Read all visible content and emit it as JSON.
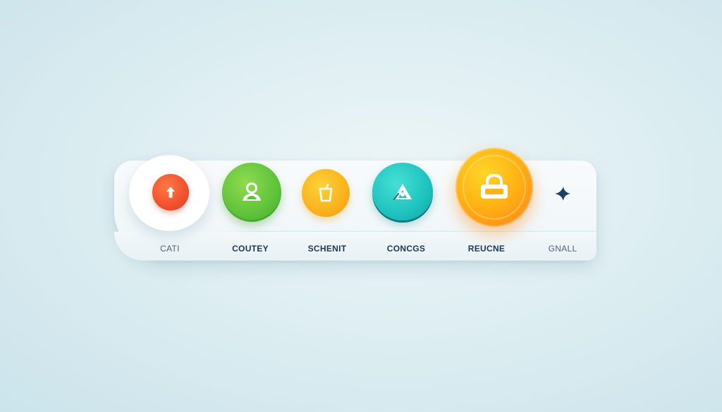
{
  "dock": {
    "items": [
      {
        "id": "cati",
        "label": "CATI",
        "color": "#f0502f",
        "icon": "arrow-up-icon"
      },
      {
        "id": "coutey",
        "label": "COUTEY",
        "color": "#5fc23a",
        "icon": "user-icon"
      },
      {
        "id": "schenit",
        "label": "SCHENIT",
        "color": "#f9b21c",
        "icon": "cup-icon"
      },
      {
        "id": "concgs",
        "label": "CONCGS",
        "color": "#1ec2be",
        "icon": "triangle-icon"
      },
      {
        "id": "reucne",
        "label": "REUCNE",
        "color": "#ff9f18",
        "icon": "lock-icon"
      },
      {
        "id": "gnall",
        "label": "GNALL",
        "color": "#1f3f66",
        "icon": "sparkle-icon"
      }
    ]
  }
}
